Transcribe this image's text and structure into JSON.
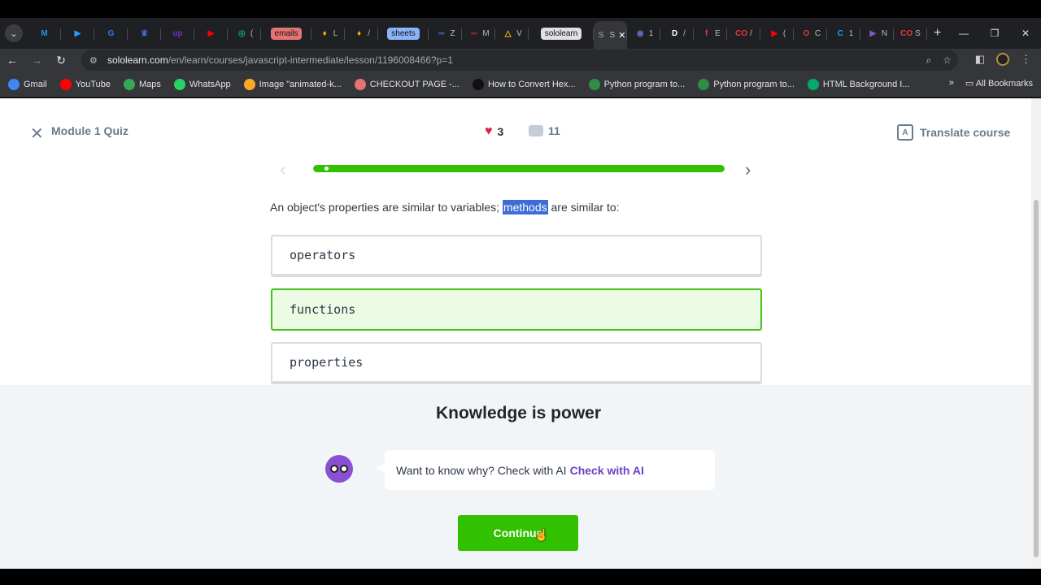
{
  "browser": {
    "tabs": [
      {
        "icon": "gmail-m-icon",
        "label": "",
        "color": "#1a9bd7",
        "glyph": "M"
      },
      {
        "icon": "play-icon",
        "label": "",
        "color": "#1fa1ff",
        "glyph": "▶"
      },
      {
        "icon": "grammarly-icon",
        "label": "",
        "color": "#2a78f0",
        "glyph": "G"
      },
      {
        "icon": "crown-icon",
        "label": "",
        "color": "#3d68d8",
        "glyph": "♛"
      },
      {
        "icon": "upwork-icon",
        "label": "",
        "color": "#6a31c8",
        "glyph": "up"
      },
      {
        "icon": "youtube-icon",
        "label": "",
        "color": "#ff0000",
        "glyph": "▶"
      },
      {
        "icon": "chatgpt-icon",
        "label": "(",
        "color": "#10a37f",
        "glyph": "◎"
      },
      {
        "icon": "emails-pill",
        "label": "emails",
        "color": "#e57373",
        "glyph": ""
      },
      {
        "icon": "maps-pin-icon",
        "label": "L",
        "color": "#f4b400",
        "glyph": "♦"
      },
      {
        "icon": "maps-pin-icon",
        "label": "/",
        "color": "#f4b400",
        "glyph": "♦"
      },
      {
        "icon": "sheets-pill",
        "label": "sheets",
        "color": "#8ab4f8",
        "glyph": ""
      },
      {
        "icon": "docs-icon",
        "label": "Z",
        "color": "#4285f4",
        "glyph": "═"
      },
      {
        "icon": "bank-icon",
        "label": "M",
        "color": "#d32f2f",
        "glyph": "═"
      },
      {
        "icon": "drive-icon",
        "label": "V",
        "color": "#fbbc04",
        "glyph": "△"
      },
      {
        "icon": "sololearn-pill",
        "label": "sololearn",
        "color": "#e0e0e0",
        "glyph": ""
      },
      {
        "icon": "sololearn-icon",
        "label": "S",
        "color": "#888888",
        "glyph": "S",
        "active": true
      },
      {
        "icon": "globe-icon",
        "label": "1",
        "color": "#5c6bc0",
        "glyph": "◉"
      },
      {
        "icon": "d-icon",
        "label": "/",
        "color": "#ffffff",
        "glyph": "D"
      },
      {
        "icon": "f-icon",
        "label": "E",
        "color": "#e53935",
        "glyph": "f"
      },
      {
        "icon": "codeforces-icon",
        "label": "/",
        "color": "#e53935",
        "glyph": "CO"
      },
      {
        "icon": "youtube-icon",
        "label": "(",
        "color": "#ff0000",
        "glyph": "▶"
      },
      {
        "icon": "opera-icon",
        "label": "C",
        "color": "#e53935",
        "glyph": "O"
      },
      {
        "icon": "chrome-icon",
        "label": "1",
        "color": "#03a9f4",
        "glyph": "C"
      },
      {
        "icon": "video-icon",
        "label": "N",
        "color": "#7e57c2",
        "glyph": "▶"
      },
      {
        "icon": "codeforces-icon",
        "label": "S",
        "color": "#e53935",
        "glyph": "CO"
      }
    ],
    "url_host": "sololearn.com",
    "url_path": "/en/learn/courses/javascript-intermediate/lesson/1196008466?p=1",
    "bookmarks": [
      {
        "label": "Gmail",
        "icon": "google-icon",
        "color": "#4285f4"
      },
      {
        "label": "YouTube",
        "icon": "youtube-icon",
        "color": "#ff0000"
      },
      {
        "label": "Maps",
        "icon": "maps-icon",
        "color": "#34a853"
      },
      {
        "label": "WhatsApp",
        "icon": "whatsapp-icon",
        "color": "#25d366"
      },
      {
        "label": "Image \"animated-k...",
        "icon": "star-icon",
        "color": "#f9a825"
      },
      {
        "label": "CHECKOUT PAGE -...",
        "icon": "lips-icon",
        "color": "#e57373"
      },
      {
        "label": "How to Convert Hex...",
        "icon": "alpha-icon",
        "color": "#111111"
      },
      {
        "label": "Python program to...",
        "icon": "gfg-icon",
        "color": "#2f8d46"
      },
      {
        "label": "Python program to...",
        "icon": "gfg-icon",
        "color": "#2f8d46"
      },
      {
        "label": "HTML Background I...",
        "icon": "w-icon",
        "color": "#04aa6d"
      }
    ],
    "all_bookmarks": "All Bookmarks"
  },
  "header": {
    "module_title": "Module 1 Quiz",
    "hearts": "3",
    "comments": "11",
    "translate": "Translate course"
  },
  "progress": {
    "fraction": 1.0,
    "color": "#32c100"
  },
  "question": {
    "before": "An object's properties are similar to variables; ",
    "highlight": "methods",
    "after": " are similar to:"
  },
  "options": [
    {
      "label": "operators",
      "correct": false
    },
    {
      "label": "functions",
      "correct": true
    },
    {
      "label": "properties",
      "correct": false
    }
  ],
  "feedback": {
    "title": "Knowledge is power",
    "ai_text": "Want to know why? Check with AI",
    "ai_link": "Check with AI",
    "continue": "Continue"
  }
}
